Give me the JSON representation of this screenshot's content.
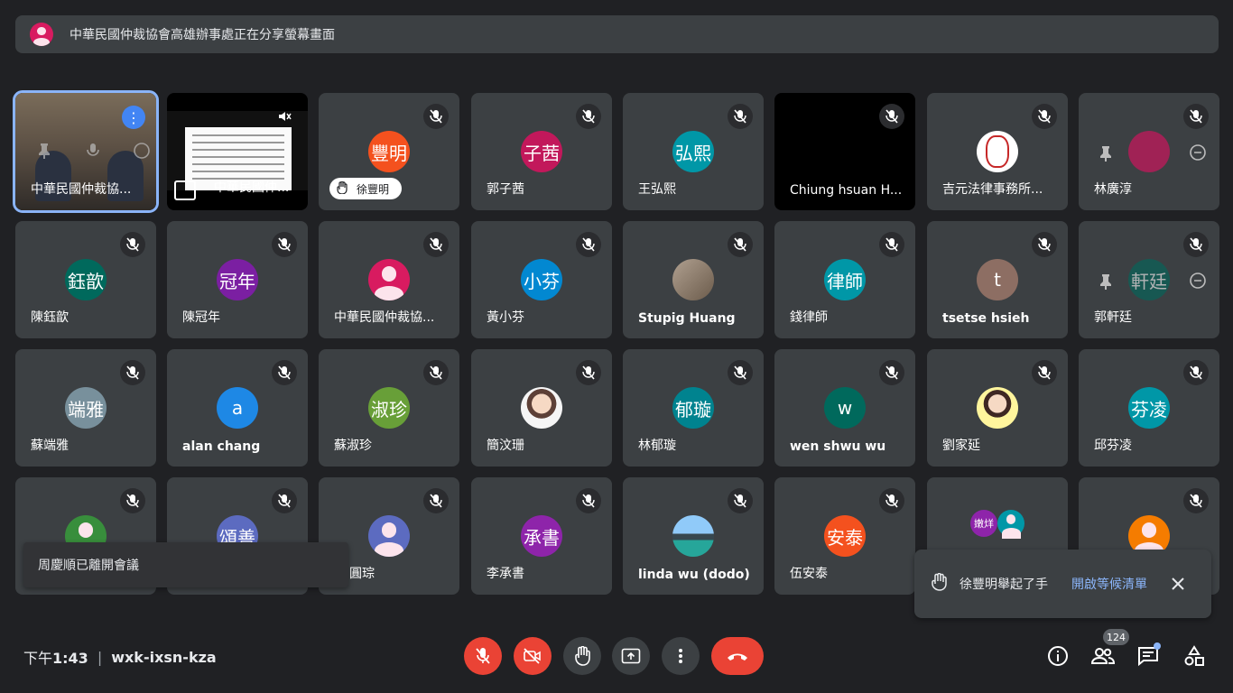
{
  "banner": {
    "text": "中華民國仲裁協會高雄辦事處正在分享螢幕畫面"
  },
  "tiles": [
    {
      "name": "中華民國仲裁協..."
    },
    {
      "name": "中華民國仲..."
    },
    {
      "avatar": "豐明",
      "name": "",
      "chip": "徐豐明"
    },
    {
      "avatar": "子茜",
      "name": "郭子茜"
    },
    {
      "avatar": "弘熙",
      "name": "王弘熙"
    },
    {
      "name": "Chiung hsuan H..."
    },
    {
      "name": "吉元法律事務所..."
    },
    {
      "name": "林廣淳"
    },
    {
      "avatar": "鈺歆",
      "name": "陳鈺歆"
    },
    {
      "avatar": "冠年",
      "name": "陳冠年"
    },
    {
      "name": "中華民國仲裁協..."
    },
    {
      "avatar": "小芬",
      "name": "黃小芬"
    },
    {
      "name": "Stupig Huang"
    },
    {
      "avatar": "律師",
      "name": "錢律師"
    },
    {
      "avatar": "t",
      "name": "tsetse hsieh"
    },
    {
      "avatar": "軒廷",
      "name": "郭軒廷"
    },
    {
      "avatar": "端雅",
      "name": "蘇端雅"
    },
    {
      "avatar": "a",
      "name": "alan chang"
    },
    {
      "avatar": "淑珍",
      "name": "蘇淑珍"
    },
    {
      "name": "簡汶珊"
    },
    {
      "avatar": "郁璇",
      "name": "林郁璇"
    },
    {
      "avatar": "w",
      "name": "wen shwu wu"
    },
    {
      "name": "劉家延"
    },
    {
      "avatar": "芬凌",
      "name": "邱芬凌"
    },
    {
      "avatar": "",
      "name": ""
    },
    {
      "avatar": "頌善",
      "name": ""
    },
    {
      "name": "圓琮"
    },
    {
      "avatar": "承書",
      "name": "李承書"
    },
    {
      "name": "linda wu (dodo)"
    },
    {
      "avatar": "安泰",
      "name": "伍安泰"
    },
    {
      "avatar_small": "嫩烊",
      "name": ""
    },
    {
      "name": ""
    }
  ],
  "toast": {
    "text": "周慶順已離開會議"
  },
  "hand_notice": {
    "text": "徐豐明舉起了手",
    "link": "開啟等候清單"
  },
  "footer": {
    "time_prefix": "下午",
    "time": "1:43",
    "separator": "|",
    "code": "wxk-ixsn-kza",
    "participants": "124"
  },
  "colors": {
    "background": "#202124",
    "tile": "#3c4043",
    "red": "#ea4335",
    "link": "#8ab4f8"
  }
}
